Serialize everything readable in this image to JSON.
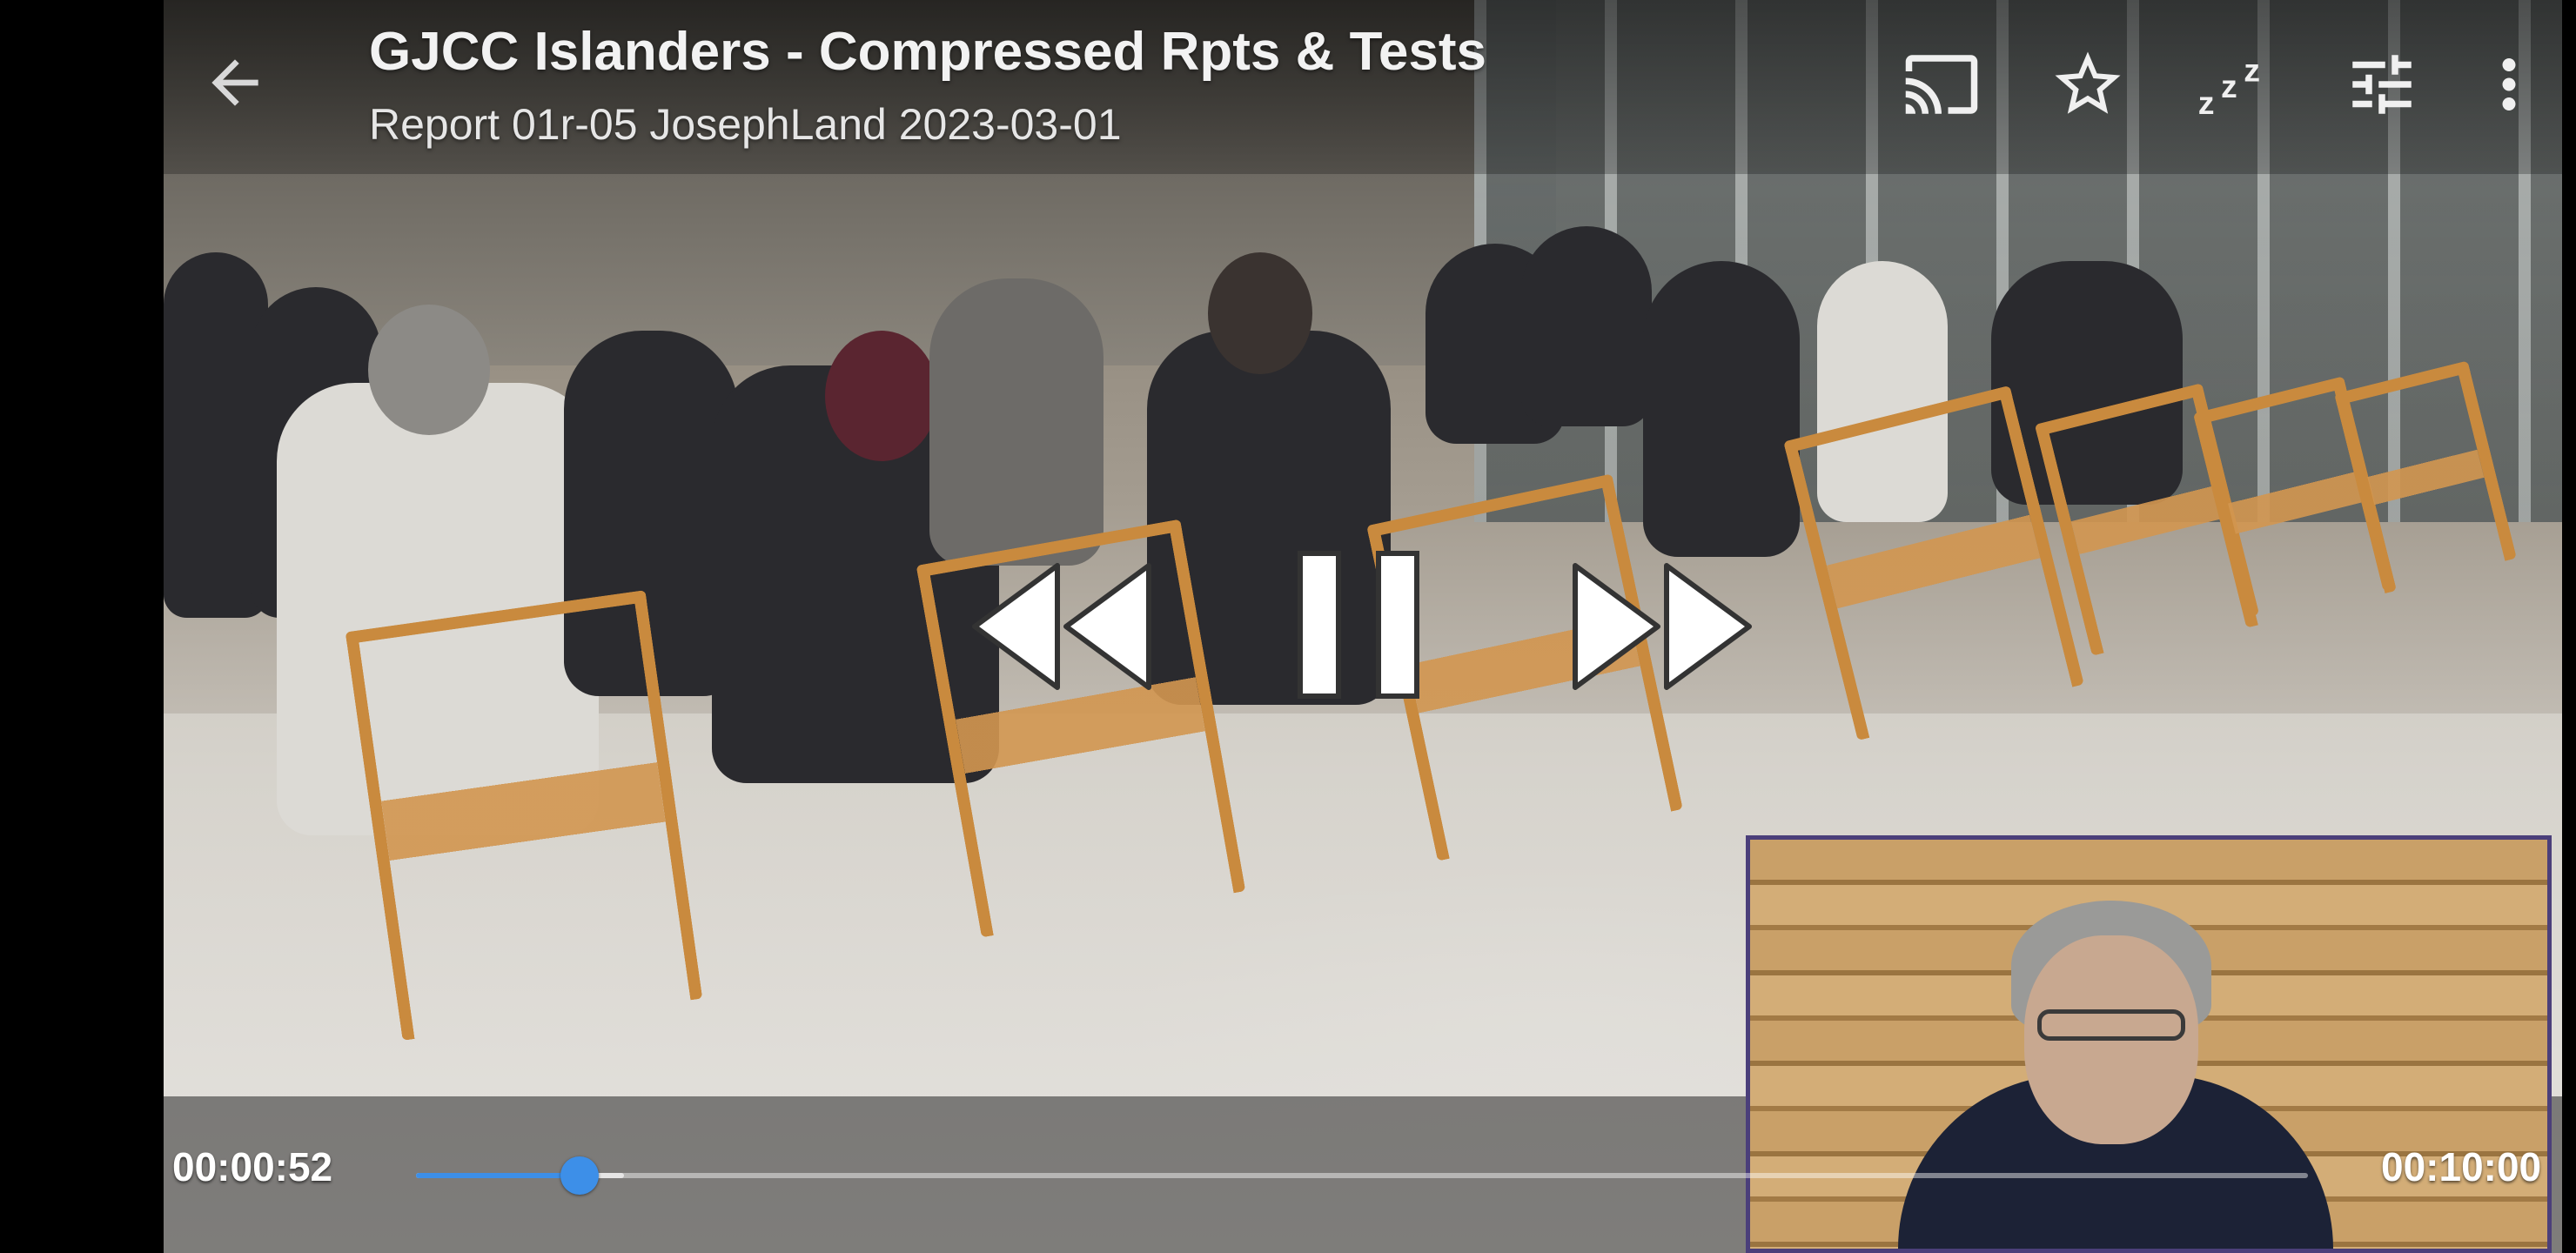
{
  "player": {
    "title": "GJCC Islanders - Compressed Rpts & Tests",
    "subtitle": "Report 01r-05 JosephLand 2023-03-01",
    "current_time": "00:00:52",
    "duration": "00:10:00",
    "progress_fraction": 0.0867,
    "buffered_fraction": 0.11,
    "accent_color": "#3d8fe8"
  },
  "toolbar": {
    "icons": [
      "back-arrow-icon",
      "cast-icon",
      "star-icon",
      "sleep-timer-icon",
      "equalizer-icon",
      "more-vert-icon"
    ]
  },
  "controls": {
    "icons": [
      "rewind-icon",
      "pause-icon",
      "fast-forward-icon"
    ]
  }
}
